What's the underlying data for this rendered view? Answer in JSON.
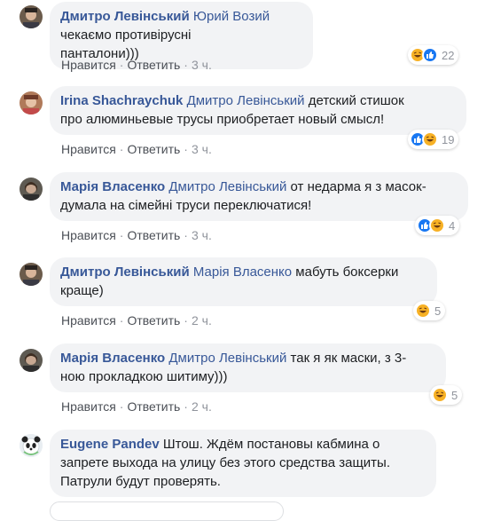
{
  "comments": [
    {
      "author": "Дмитро Левінський",
      "mention": "Юрий Возий",
      "text_line1": "чекаємо противірусні",
      "text_line2": "панталони)))",
      "like_label": "Нравится",
      "reply_label": "Ответить",
      "time": "3 ч.",
      "reactions": [
        "haha",
        "like"
      ],
      "reaction_count": "22"
    },
    {
      "author": "Irina Shachraychuk",
      "mention": "Дмитро Левінський",
      "text_line1": "детский стишок",
      "text_line2": "про алюминьевые трусы приобретает новый смысл!",
      "like_label": "Нравится",
      "reply_label": "Ответить",
      "time": "3 ч.",
      "reactions": [
        "like",
        "haha"
      ],
      "reaction_count": "19"
    },
    {
      "author": "Марія Власенко",
      "mention": "Дмитро Левінський",
      "text_line1": "от недарма я з масок-",
      "text_line2": "думала на сімейні труси переключатися!",
      "like_label": "Нравится",
      "reply_label": "Ответить",
      "time": "3 ч.",
      "reactions": [
        "like",
        "haha"
      ],
      "reaction_count": "4"
    },
    {
      "author": "Дмитро Левінський",
      "mention": "Марія Власенко",
      "text_line1": "мабуть боксерки",
      "text_line2": "краще)",
      "like_label": "Нравится",
      "reply_label": "Ответить",
      "time": "2 ч.",
      "reactions": [
        "haha"
      ],
      "reaction_count": "5"
    },
    {
      "author": "Марія Власенко",
      "mention": "Дмитро Левінський",
      "text_line1": "так я як маски, з 3-",
      "text_line2": "ною прокладкою шитиму)))",
      "like_label": "Нравится",
      "reply_label": "Ответить",
      "time": "2 ч.",
      "reactions": [
        "haha"
      ],
      "reaction_count": "5"
    },
    {
      "author": "Eugene Pandev",
      "mention": "",
      "text_line1": "Штош. Ждём постановы кабмина о",
      "text_line2": "запрете выхода на улицу без этого средства защиты.",
      "text_line3": "Патрули будут проверять."
    }
  ],
  "separator": "·",
  "colors": {
    "author": "#385898",
    "bubble_bg": "#f2f3f5",
    "meta": "#90949c",
    "like_blue": "#1877f2",
    "haha_yellow": "#f7b125"
  }
}
